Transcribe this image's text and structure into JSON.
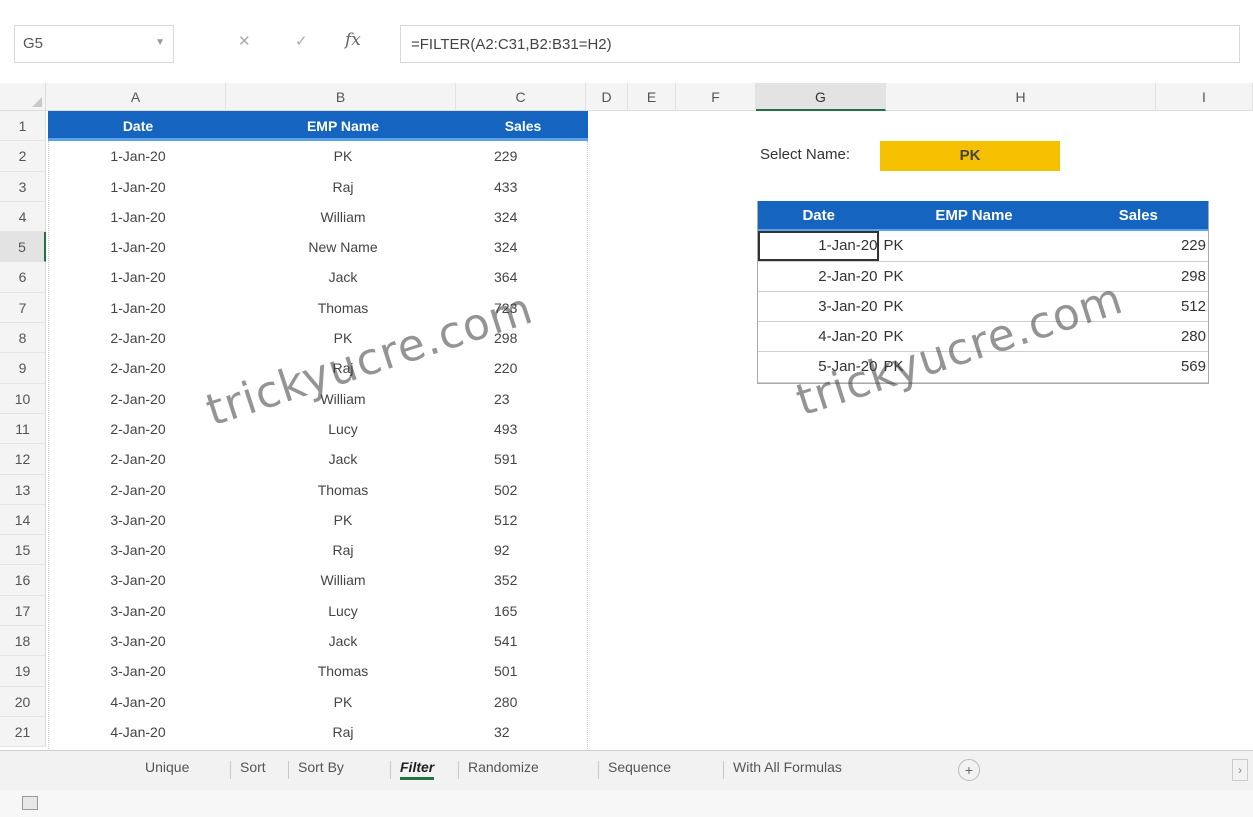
{
  "formula_bar": {
    "name_box": "G5",
    "fx_label": "fx",
    "cancel_icon": "x-icon",
    "enter_icon": "check-icon",
    "formula": "=FILTER(A2:C31,B2:B31=H2)"
  },
  "columns": [
    "A",
    "B",
    "C",
    "D",
    "E",
    "F",
    "G",
    "H",
    "I"
  ],
  "rows": [
    "1",
    "2",
    "3",
    "4",
    "5",
    "6",
    "7",
    "8",
    "9",
    "10",
    "11",
    "12",
    "13",
    "14",
    "15",
    "16",
    "17",
    "18",
    "19",
    "20",
    "21"
  ],
  "active_row": "5",
  "active_col": "G",
  "data_table": {
    "headers": {
      "date": "Date",
      "name": "EMP Name",
      "sales": "Sales"
    },
    "rows": [
      {
        "date": "1-Jan-20",
        "name": "PK",
        "sales": "229"
      },
      {
        "date": "1-Jan-20",
        "name": "Raj",
        "sales": "433"
      },
      {
        "date": "1-Jan-20",
        "name": "William",
        "sales": "324"
      },
      {
        "date": "1-Jan-20",
        "name": "New Name",
        "sales": "324"
      },
      {
        "date": "1-Jan-20",
        "name": "Jack",
        "sales": "364"
      },
      {
        "date": "1-Jan-20",
        "name": "Thomas",
        "sales": "723"
      },
      {
        "date": "2-Jan-20",
        "name": "PK",
        "sales": "298"
      },
      {
        "date": "2-Jan-20",
        "name": "Raj",
        "sales": "220"
      },
      {
        "date": "2-Jan-20",
        "name": "William",
        "sales": "23"
      },
      {
        "date": "2-Jan-20",
        "name": "Lucy",
        "sales": "493"
      },
      {
        "date": "2-Jan-20",
        "name": "Jack",
        "sales": "591"
      },
      {
        "date": "2-Jan-20",
        "name": "Thomas",
        "sales": "502"
      },
      {
        "date": "3-Jan-20",
        "name": "PK",
        "sales": "512"
      },
      {
        "date": "3-Jan-20",
        "name": "Raj",
        "sales": "92"
      },
      {
        "date": "3-Jan-20",
        "name": "William",
        "sales": "352"
      },
      {
        "date": "3-Jan-20",
        "name": "Lucy",
        "sales": "165"
      },
      {
        "date": "3-Jan-20",
        "name": "Jack",
        "sales": "541"
      },
      {
        "date": "3-Jan-20",
        "name": "Thomas",
        "sales": "501"
      },
      {
        "date": "4-Jan-20",
        "name": "PK",
        "sales": "280"
      },
      {
        "date": "4-Jan-20",
        "name": "Raj",
        "sales": "32"
      }
    ]
  },
  "select_name": {
    "label": "Select Name:",
    "value": "PK"
  },
  "result_table": {
    "headers": {
      "date": "Date",
      "name": "EMP Name",
      "sales": "Sales"
    },
    "rows": [
      {
        "date": "1-Jan-20",
        "name": "PK",
        "sales": "229"
      },
      {
        "date": "2-Jan-20",
        "name": "PK",
        "sales": "298"
      },
      {
        "date": "3-Jan-20",
        "name": "PK",
        "sales": "512"
      },
      {
        "date": "4-Jan-20",
        "name": "PK",
        "sales": "280"
      },
      {
        "date": "5-Jan-20",
        "name": "PK",
        "sales": "569"
      }
    ]
  },
  "watermark": "trickyucre.com",
  "sheet_tabs": [
    "Unique",
    "Sort",
    "Sort By",
    "Filter",
    "Randomize",
    "Sequence",
    "With All Formulas"
  ],
  "active_tab": "Filter",
  "colors": {
    "header_blue": "#1565c0",
    "select_yellow": "#f5c000",
    "excel_green": "#217346"
  }
}
